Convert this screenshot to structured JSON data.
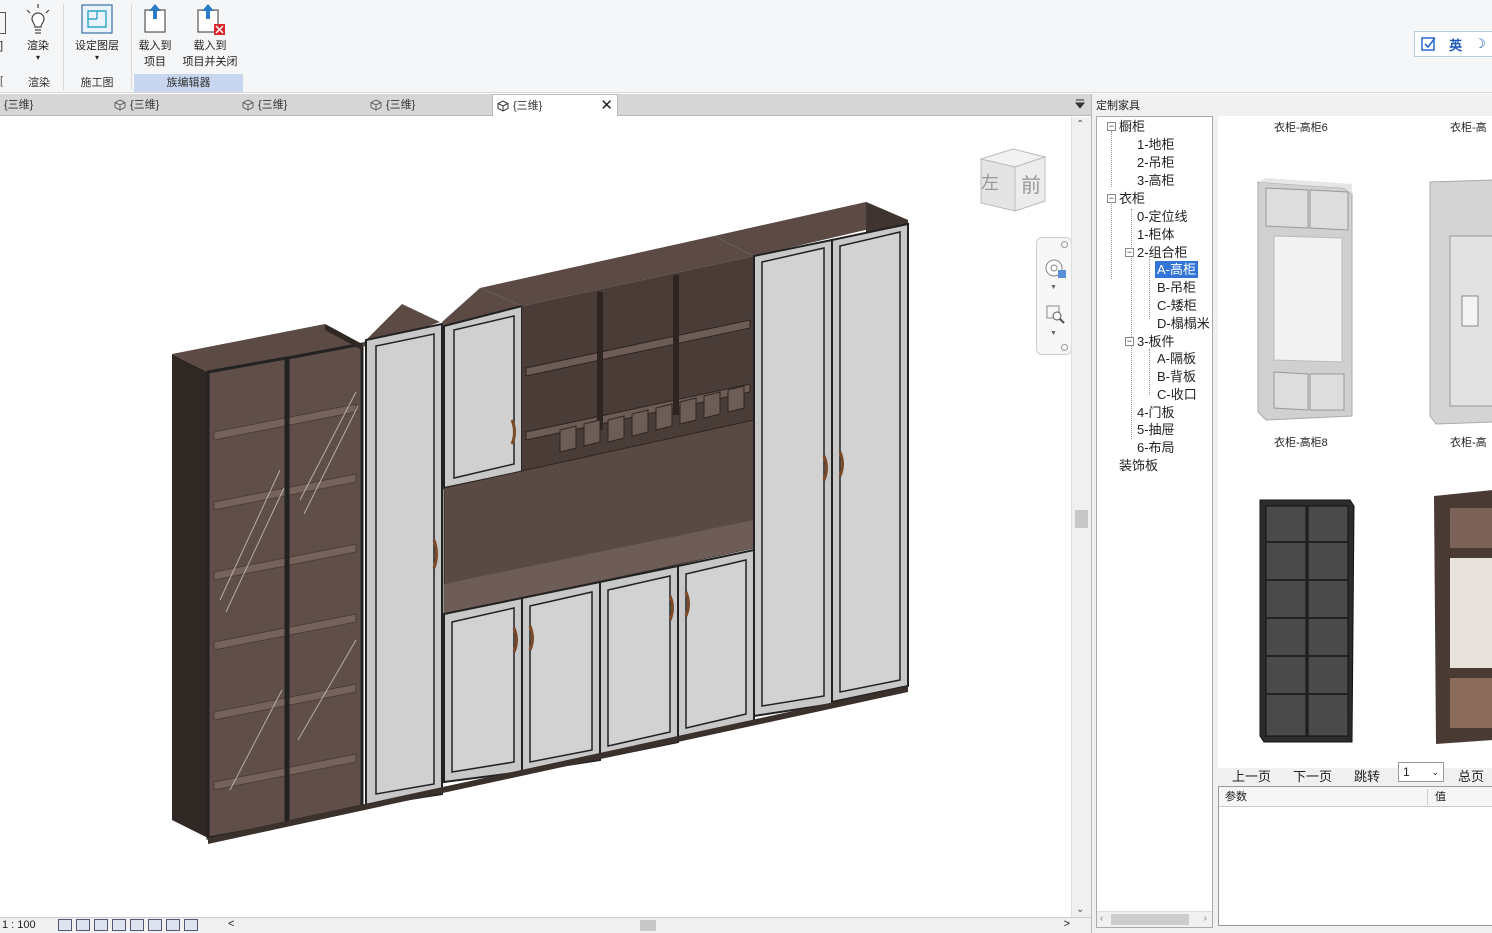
{
  "ribbon": {
    "buttons": [
      {
        "name": "render",
        "label": "渲染",
        "arrow": "▾"
      },
      {
        "name": "set-layer",
        "label": "设定图层",
        "arrow": "▾"
      },
      {
        "name": "load-to-project",
        "label": "载入到",
        "label2": "项目"
      },
      {
        "name": "load-close",
        "label": "载入到",
        "label2": "项目并关闭"
      }
    ],
    "groups": [
      "渲染",
      "施工图",
      "族编辑器"
    ],
    "ime": {
      "lang": "英",
      "moon": "☽"
    }
  },
  "tabs": [
    {
      "label": "{三维}",
      "active": false
    },
    {
      "label": "{三维}",
      "active": false
    },
    {
      "label": "{三维}",
      "active": false
    },
    {
      "label": "{三维}",
      "active": false
    },
    {
      "label": "{三维}",
      "active": true,
      "close": "✕"
    }
  ],
  "viewcube": {
    "left": "左",
    "front": "前"
  },
  "status": {
    "scale": "1 : 100",
    "left_arrow": "<",
    "right_arrow": ">"
  },
  "panel": {
    "title": "定制家具",
    "tree": [
      {
        "label": "橱柜",
        "toggle": "−"
      },
      {
        "label": "1-地柜"
      },
      {
        "label": "2-吊柜"
      },
      {
        "label": "3-高柜"
      },
      {
        "label": "衣柜",
        "toggle": "−"
      },
      {
        "label": "0-定位线"
      },
      {
        "label": "1-柜体"
      },
      {
        "label": "2-组合柜",
        "toggle": "−"
      },
      {
        "label": "A-高柜",
        "selected": true
      },
      {
        "label": "B-吊柜"
      },
      {
        "label": "C-矮柜"
      },
      {
        "label": "D-榻榻米"
      },
      {
        "label": "3-板件",
        "toggle": "−"
      },
      {
        "label": "A-隔板"
      },
      {
        "label": "B-背板"
      },
      {
        "label": "C-收口"
      },
      {
        "label": "4-门板"
      },
      {
        "label": "5-抽屉"
      },
      {
        "label": "6-布局"
      },
      {
        "label": "装饰板"
      }
    ],
    "gallery_captions": [
      "衣柜-高柜6",
      "衣柜-高",
      "衣柜-高柜8",
      "衣柜-高"
    ],
    "pager": {
      "prev": "上一页",
      "next": "下一页",
      "jump": "跳转",
      "page": "1",
      "total": "总页数"
    },
    "params": {
      "col1": "参数",
      "col2": "值"
    }
  },
  "colors": {
    "wood": "#5a4a44",
    "wood_dark": "#3a302c",
    "door": "#cfcfcf",
    "selection": "#3173d6"
  }
}
